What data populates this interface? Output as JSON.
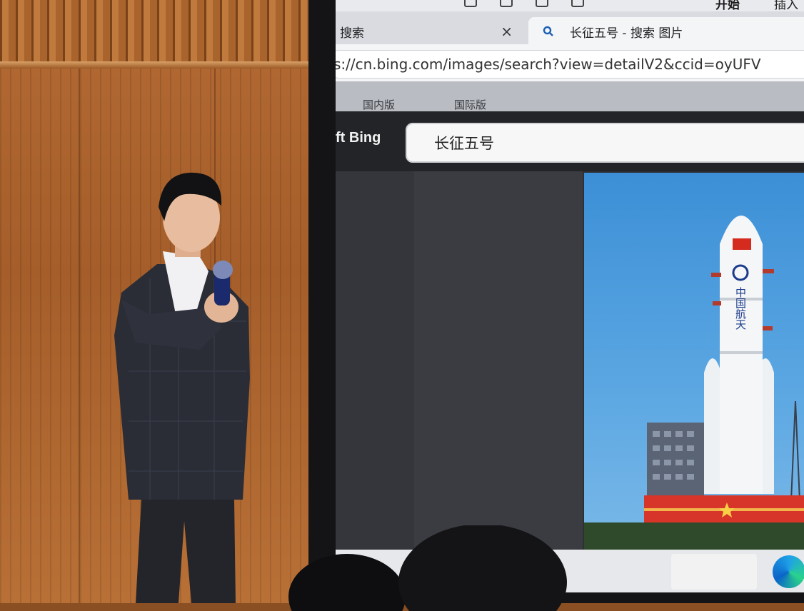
{
  "browser": {
    "ribbon": {
      "start_label": "开始",
      "insert_label": "插入"
    },
    "tabs": [
      {
        "title": "搜索",
        "close_symbol": "×"
      },
      {
        "title": "长征五号 - 搜索 图片"
      }
    ],
    "address_bar": {
      "url": "s://cn.bing.com/images/search?view=detailV2&ccid=oyUFV"
    }
  },
  "bing": {
    "nav": [
      "国内版",
      "国际版"
    ],
    "logo_text": "ft Bing",
    "search_query": "长征五号"
  },
  "photo": {
    "subject": "Long March 5 rocket on launch pad",
    "rocket_body_text": "中国航天"
  },
  "colors": {
    "wood": "#b06a33",
    "sky": "#4a98dc",
    "bing_header": "#232427",
    "launch_platform": "#d8352a"
  },
  "icons": {
    "search": "search-icon",
    "close": "close-icon",
    "edge": "edge-browser-icon"
  }
}
